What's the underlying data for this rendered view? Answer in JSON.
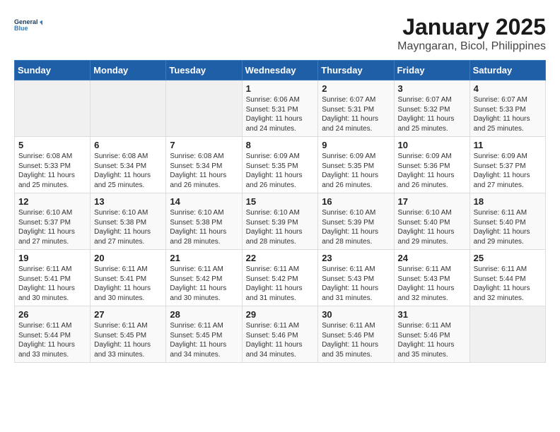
{
  "header": {
    "logo_line1": "General",
    "logo_line2": "Blue",
    "month": "January 2025",
    "location": "Mayngaran, Bicol, Philippines"
  },
  "weekdays": [
    "Sunday",
    "Monday",
    "Tuesday",
    "Wednesday",
    "Thursday",
    "Friday",
    "Saturday"
  ],
  "weeks": [
    [
      {
        "day": "",
        "empty": true
      },
      {
        "day": "",
        "empty": true
      },
      {
        "day": "",
        "empty": true
      },
      {
        "day": "1",
        "sunrise": "6:06 AM",
        "sunset": "5:31 PM",
        "daylight": "11 hours and 24 minutes."
      },
      {
        "day": "2",
        "sunrise": "6:07 AM",
        "sunset": "5:31 PM",
        "daylight": "11 hours and 24 minutes."
      },
      {
        "day": "3",
        "sunrise": "6:07 AM",
        "sunset": "5:32 PM",
        "daylight": "11 hours and 25 minutes."
      },
      {
        "day": "4",
        "sunrise": "6:07 AM",
        "sunset": "5:33 PM",
        "daylight": "11 hours and 25 minutes."
      }
    ],
    [
      {
        "day": "5",
        "sunrise": "6:08 AM",
        "sunset": "5:33 PM",
        "daylight": "11 hours and 25 minutes."
      },
      {
        "day": "6",
        "sunrise": "6:08 AM",
        "sunset": "5:34 PM",
        "daylight": "11 hours and 25 minutes."
      },
      {
        "day": "7",
        "sunrise": "6:08 AM",
        "sunset": "5:34 PM",
        "daylight": "11 hours and 26 minutes."
      },
      {
        "day": "8",
        "sunrise": "6:09 AM",
        "sunset": "5:35 PM",
        "daylight": "11 hours and 26 minutes."
      },
      {
        "day": "9",
        "sunrise": "6:09 AM",
        "sunset": "5:35 PM",
        "daylight": "11 hours and 26 minutes."
      },
      {
        "day": "10",
        "sunrise": "6:09 AM",
        "sunset": "5:36 PM",
        "daylight": "11 hours and 26 minutes."
      },
      {
        "day": "11",
        "sunrise": "6:09 AM",
        "sunset": "5:37 PM",
        "daylight": "11 hours and 27 minutes."
      }
    ],
    [
      {
        "day": "12",
        "sunrise": "6:10 AM",
        "sunset": "5:37 PM",
        "daylight": "11 hours and 27 minutes."
      },
      {
        "day": "13",
        "sunrise": "6:10 AM",
        "sunset": "5:38 PM",
        "daylight": "11 hours and 27 minutes."
      },
      {
        "day": "14",
        "sunrise": "6:10 AM",
        "sunset": "5:38 PM",
        "daylight": "11 hours and 28 minutes."
      },
      {
        "day": "15",
        "sunrise": "6:10 AM",
        "sunset": "5:39 PM",
        "daylight": "11 hours and 28 minutes."
      },
      {
        "day": "16",
        "sunrise": "6:10 AM",
        "sunset": "5:39 PM",
        "daylight": "11 hours and 28 minutes."
      },
      {
        "day": "17",
        "sunrise": "6:10 AM",
        "sunset": "5:40 PM",
        "daylight": "11 hours and 29 minutes."
      },
      {
        "day": "18",
        "sunrise": "6:11 AM",
        "sunset": "5:40 PM",
        "daylight": "11 hours and 29 minutes."
      }
    ],
    [
      {
        "day": "19",
        "sunrise": "6:11 AM",
        "sunset": "5:41 PM",
        "daylight": "11 hours and 30 minutes."
      },
      {
        "day": "20",
        "sunrise": "6:11 AM",
        "sunset": "5:41 PM",
        "daylight": "11 hours and 30 minutes."
      },
      {
        "day": "21",
        "sunrise": "6:11 AM",
        "sunset": "5:42 PM",
        "daylight": "11 hours and 30 minutes."
      },
      {
        "day": "22",
        "sunrise": "6:11 AM",
        "sunset": "5:42 PM",
        "daylight": "11 hours and 31 minutes."
      },
      {
        "day": "23",
        "sunrise": "6:11 AM",
        "sunset": "5:43 PM",
        "daylight": "11 hours and 31 minutes."
      },
      {
        "day": "24",
        "sunrise": "6:11 AM",
        "sunset": "5:43 PM",
        "daylight": "11 hours and 32 minutes."
      },
      {
        "day": "25",
        "sunrise": "6:11 AM",
        "sunset": "5:44 PM",
        "daylight": "11 hours and 32 minutes."
      }
    ],
    [
      {
        "day": "26",
        "sunrise": "6:11 AM",
        "sunset": "5:44 PM",
        "daylight": "11 hours and 33 minutes."
      },
      {
        "day": "27",
        "sunrise": "6:11 AM",
        "sunset": "5:45 PM",
        "daylight": "11 hours and 33 minutes."
      },
      {
        "day": "28",
        "sunrise": "6:11 AM",
        "sunset": "5:45 PM",
        "daylight": "11 hours and 34 minutes."
      },
      {
        "day": "29",
        "sunrise": "6:11 AM",
        "sunset": "5:46 PM",
        "daylight": "11 hours and 34 minutes."
      },
      {
        "day": "30",
        "sunrise": "6:11 AM",
        "sunset": "5:46 PM",
        "daylight": "11 hours and 35 minutes."
      },
      {
        "day": "31",
        "sunrise": "6:11 AM",
        "sunset": "5:46 PM",
        "daylight": "11 hours and 35 minutes."
      },
      {
        "day": "",
        "empty": true
      }
    ]
  ]
}
